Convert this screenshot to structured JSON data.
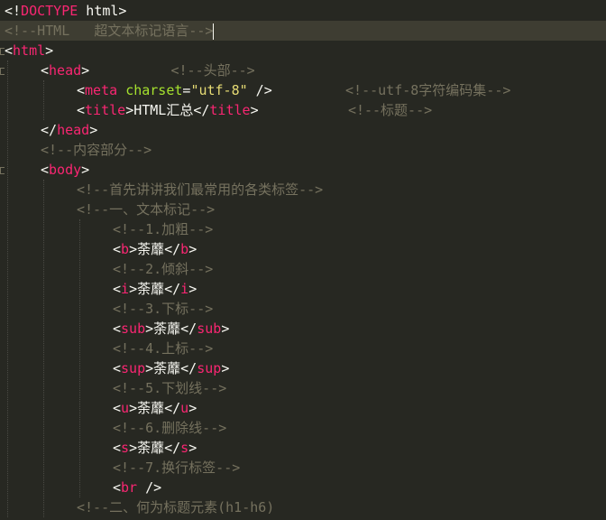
{
  "code": {
    "lines": [
      {
        "indent": 0,
        "fold": false,
        "current": false,
        "tokens": [
          {
            "t": "p",
            "v": "<!"
          },
          {
            "t": "t",
            "v": "DOCTYPE"
          },
          {
            "t": "p",
            "v": " html>"
          }
        ]
      },
      {
        "indent": 0,
        "fold": false,
        "current": true,
        "caret": true,
        "tokens": [
          {
            "t": "c",
            "v": "<!--HTML   超文本标记语言-->"
          }
        ]
      },
      {
        "indent": 0,
        "fold": true,
        "current": false,
        "tokens": [
          {
            "t": "p",
            "v": "<"
          },
          {
            "t": "t",
            "v": "html"
          },
          {
            "t": "p",
            "v": ">"
          }
        ]
      },
      {
        "indent": 1,
        "fold": true,
        "current": false,
        "tokens": [
          {
            "t": "p",
            "v": "<"
          },
          {
            "t": "t",
            "v": "head"
          },
          {
            "t": "p",
            "v": ">"
          },
          {
            "t": "p",
            "v": "          "
          },
          {
            "t": "c",
            "v": "<!--头部-->"
          }
        ]
      },
      {
        "indent": 2,
        "fold": false,
        "current": false,
        "tokens": [
          {
            "t": "p",
            "v": "<"
          },
          {
            "t": "t",
            "v": "meta"
          },
          {
            "t": "p",
            "v": " "
          },
          {
            "t": "a",
            "v": "charset"
          },
          {
            "t": "p",
            "v": "="
          },
          {
            "t": "s",
            "v": "\"utf-8\""
          },
          {
            "t": "p",
            "v": " />"
          },
          {
            "t": "p",
            "v": "         "
          },
          {
            "t": "c",
            "v": "<!--utf-8字符编码集-->"
          }
        ]
      },
      {
        "indent": 2,
        "fold": false,
        "current": false,
        "tokens": [
          {
            "t": "p",
            "v": "<"
          },
          {
            "t": "t",
            "v": "title"
          },
          {
            "t": "p",
            "v": ">HTML汇总</"
          },
          {
            "t": "t",
            "v": "title"
          },
          {
            "t": "p",
            "v": ">"
          },
          {
            "t": "p",
            "v": "           "
          },
          {
            "t": "c",
            "v": "<!--标题-->"
          }
        ]
      },
      {
        "indent": 1,
        "fold": false,
        "current": false,
        "tokens": [
          {
            "t": "p",
            "v": "</"
          },
          {
            "t": "t",
            "v": "head"
          },
          {
            "t": "p",
            "v": ">"
          }
        ]
      },
      {
        "indent": 1,
        "fold": false,
        "current": false,
        "tokens": [
          {
            "t": "c",
            "v": "<!--内容部分-->"
          }
        ]
      },
      {
        "indent": 1,
        "fold": true,
        "current": false,
        "tokens": [
          {
            "t": "p",
            "v": "<"
          },
          {
            "t": "t",
            "v": "body"
          },
          {
            "t": "p",
            "v": ">"
          }
        ]
      },
      {
        "indent": 2,
        "fold": false,
        "current": false,
        "tokens": [
          {
            "t": "c",
            "v": "<!--首先讲讲我们最常用的各类标签-->"
          }
        ]
      },
      {
        "indent": 2,
        "fold": false,
        "current": false,
        "tokens": [
          {
            "t": "c",
            "v": "<!--一、文本标记-->"
          }
        ]
      },
      {
        "indent": 3,
        "fold": false,
        "current": false,
        "tokens": [
          {
            "t": "c",
            "v": "<!--1.加粗-->"
          }
        ]
      },
      {
        "indent": 3,
        "fold": false,
        "current": false,
        "tokens": [
          {
            "t": "p",
            "v": "<"
          },
          {
            "t": "t",
            "v": "b"
          },
          {
            "t": "p",
            "v": ">荼蘼</"
          },
          {
            "t": "t",
            "v": "b"
          },
          {
            "t": "p",
            "v": ">"
          }
        ]
      },
      {
        "indent": 3,
        "fold": false,
        "current": false,
        "tokens": [
          {
            "t": "c",
            "v": "<!--2.倾斜-->"
          }
        ]
      },
      {
        "indent": 3,
        "fold": false,
        "current": false,
        "tokens": [
          {
            "t": "p",
            "v": "<"
          },
          {
            "t": "t",
            "v": "i"
          },
          {
            "t": "p",
            "v": ">荼蘼</"
          },
          {
            "t": "t",
            "v": "i"
          },
          {
            "t": "p",
            "v": ">"
          }
        ]
      },
      {
        "indent": 3,
        "fold": false,
        "current": false,
        "tokens": [
          {
            "t": "c",
            "v": "<!--3.下标-->"
          }
        ]
      },
      {
        "indent": 3,
        "fold": false,
        "current": false,
        "tokens": [
          {
            "t": "p",
            "v": "<"
          },
          {
            "t": "t",
            "v": "sub"
          },
          {
            "t": "p",
            "v": ">荼蘼</"
          },
          {
            "t": "t",
            "v": "sub"
          },
          {
            "t": "p",
            "v": ">"
          }
        ]
      },
      {
        "indent": 3,
        "fold": false,
        "current": false,
        "tokens": [
          {
            "t": "c",
            "v": "<!--4.上标-->"
          }
        ]
      },
      {
        "indent": 3,
        "fold": false,
        "current": false,
        "tokens": [
          {
            "t": "p",
            "v": "<"
          },
          {
            "t": "t",
            "v": "sup"
          },
          {
            "t": "p",
            "v": ">荼蘼</"
          },
          {
            "t": "t",
            "v": "sup"
          },
          {
            "t": "p",
            "v": ">"
          }
        ]
      },
      {
        "indent": 3,
        "fold": false,
        "current": false,
        "tokens": [
          {
            "t": "c",
            "v": "<!--5.下划线-->"
          }
        ]
      },
      {
        "indent": 3,
        "fold": false,
        "current": false,
        "tokens": [
          {
            "t": "p",
            "v": "<"
          },
          {
            "t": "t",
            "v": "u"
          },
          {
            "t": "p",
            "v": ">荼蘼</"
          },
          {
            "t": "t",
            "v": "u"
          },
          {
            "t": "p",
            "v": ">"
          }
        ]
      },
      {
        "indent": 3,
        "fold": false,
        "current": false,
        "tokens": [
          {
            "t": "c",
            "v": "<!--6.删除线-->"
          }
        ]
      },
      {
        "indent": 3,
        "fold": false,
        "current": false,
        "tokens": [
          {
            "t": "p",
            "v": "<"
          },
          {
            "t": "t",
            "v": "s"
          },
          {
            "t": "p",
            "v": ">荼蘼</"
          },
          {
            "t": "t",
            "v": "s"
          },
          {
            "t": "p",
            "v": ">"
          }
        ]
      },
      {
        "indent": 3,
        "fold": false,
        "current": false,
        "tokens": [
          {
            "t": "c",
            "v": "<!--7.换行标签-->"
          }
        ]
      },
      {
        "indent": 3,
        "fold": false,
        "current": false,
        "tokens": [
          {
            "t": "p",
            "v": "<"
          },
          {
            "t": "t",
            "v": "br"
          },
          {
            "t": "p",
            "v": " />"
          }
        ]
      },
      {
        "indent": 2,
        "fold": false,
        "current": false,
        "tokens": [
          {
            "t": "c",
            "v": "<!--二、何为标题元素(h1-h6)"
          }
        ]
      }
    ]
  },
  "theme": {
    "background": "#272822",
    "current_line": "#3e3d32",
    "punctuation": "#f8f8f2",
    "tag": "#f92672",
    "attribute": "#a6e22e",
    "string": "#e6db74",
    "comment": "#75715e"
  }
}
